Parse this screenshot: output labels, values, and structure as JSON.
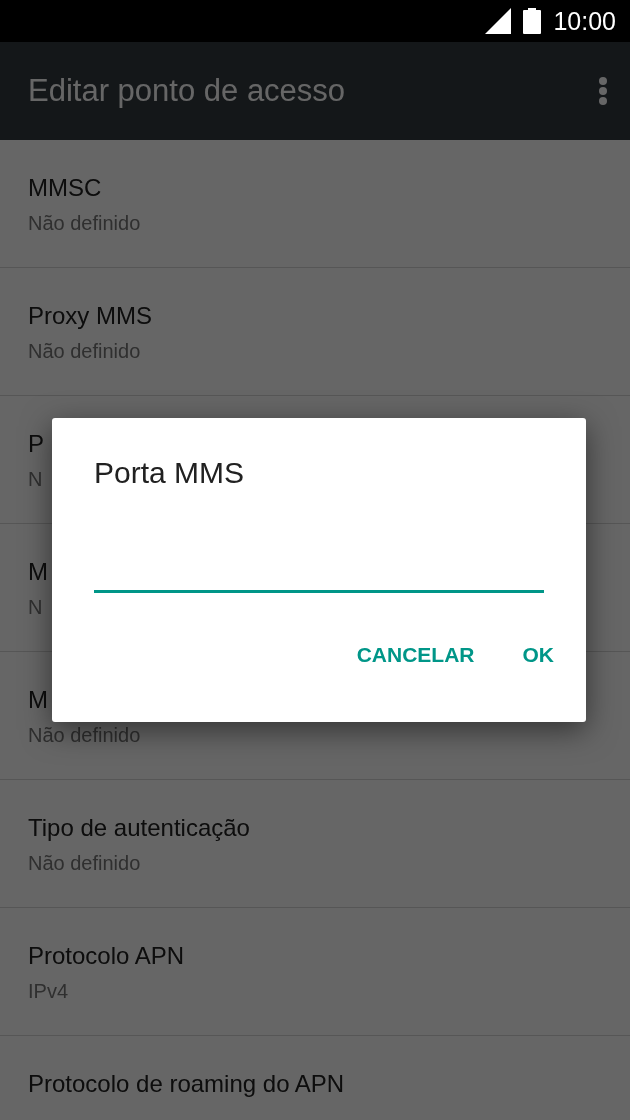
{
  "status_bar": {
    "time": "10:00"
  },
  "toolbar": {
    "title": "Editar ponto de acesso"
  },
  "settings": [
    {
      "title": "MMSC",
      "summary": "Não definido"
    },
    {
      "title": "Proxy MMS",
      "summary": "Não definido"
    },
    {
      "title": "P",
      "summary": "N"
    },
    {
      "title": "M",
      "summary": "N"
    },
    {
      "title": "M",
      "summary": "Não definido"
    },
    {
      "title": "Tipo de autenticação",
      "summary": "Não definido"
    },
    {
      "title": "Protocolo APN",
      "summary": "IPv4"
    },
    {
      "title": "Protocolo de roaming do APN"
    }
  ],
  "dialog": {
    "title": "Porta MMS",
    "field": {
      "focused": true
    },
    "buttons": [
      "CANCELAR",
      "OK"
    ]
  }
}
